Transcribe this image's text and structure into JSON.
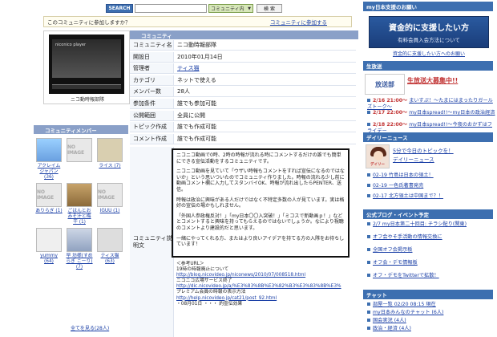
{
  "search": {
    "button": "SEARCH",
    "scope": "コミュニティ内",
    "go": "検 索"
  },
  "join": {
    "question": "このコミュニティに参加しますか？",
    "link": "コミュニティに参加する"
  },
  "left": {
    "caption": "ニコ動時報部隊",
    "members_header": "コミュニティメンバー",
    "no_image": "NO IMAGE",
    "members": [
      {
        "name": "アクレイムジャパン (36)",
        "pic": "anime"
      },
      {
        "name": "",
        "pic": "noimg"
      },
      {
        "name": "",
        "pic": "sign"
      },
      {
        "name": "もっこり (5)",
        "pic": ""
      },
      {
        "name": "ライス (7)",
        "pic": ""
      },
      {
        "name": "",
        "pic": "noimg"
      },
      {
        "name": "",
        "pic": "food"
      },
      {
        "name": "",
        "pic": "noimg"
      },
      {
        "name": "ありらぎ (1)",
        "pic": ""
      },
      {
        "name": "ごはんとおみそ汁と梅干 (1)",
        "pic": ""
      },
      {
        "name": "IGUU (1)",
        "pic": ""
      },
      {
        "name": "yummy (64)",
        "pic": "bear"
      },
      {
        "name": "早 坊様(すめらぎ こーり) (7)",
        "pic": "man"
      },
      {
        "name": "ティス猫 (63)",
        "pic": "cat"
      }
    ],
    "all_members": "全てを見る(28人)"
  },
  "info": {
    "header": "コミュニティ",
    "rows": [
      {
        "k": "コミュニティ名",
        "v": "ニコ動時報部隊"
      },
      {
        "k": "開設日",
        "v": "2010年01月14日"
      },
      {
        "k": "管理者",
        "v": "ティス猫",
        "link": true
      },
      {
        "k": "カテゴリ",
        "v": "ネットで使える"
      },
      {
        "k": "メンバー数",
        "v": "28人"
      },
      {
        "k": "参加条件",
        "v": "誰でも参加可能"
      },
      {
        "k": "公開範囲",
        "v": "全員に公開"
      },
      {
        "k": "トピック作成",
        "v": "誰でも作成可能"
      },
      {
        "k": "コメント作成",
        "v": "誰でも作成可能"
      }
    ],
    "desc_key": "コミュニティ説明文",
    "desc": [
      "ニコニコ動画で0時、2時の時報が流れる時にコメントするだけの誰でも簡単にできる宣伝活動をするコミュニティです。",
      "ニコニコ動画を見ていて「ウザい時報もコメントをすれば宣伝になるのではないか」という思いついたのでコミュニティ作りました。時報の流れる少し前に動画コメント欄に入力してスタンバイOK、時報が流れ出したらPENTER、送信。",
      "時報は政治に興味がある人だけではなく不特定多数の人が見ています。実は格好の宣伝の場かもしれません。",
      "「外国人参政権反対！」「my日本〇〇入突破！」「ミコスで新動画ｐ！」などとコメントすると興味を持ってもらえるのではないでしょうか。なにより視聴のコメントより建設的だと思います。",
      "一緒にやってくれる方、またはより良いアイデアを持てる方の入隊をお待ちしています！"
    ],
    "refs": [
      {
        "t": "＜参考URL＞",
        "u": false
      },
      {
        "t": "19時の時報廃止について",
        "u": false
      },
      {
        "t": "http://blog.nicovideo.jp/niconews/2010/07/008518.html",
        "u": true
      },
      {
        "t": "ニコニコ広場サービス終了",
        "u": false
      },
      {
        "t": "http://dic.nicovideo.jp/a/%E3%83%8B%E3%82%B3%E3%83%8B%E3%",
        "u": true
      },
      {
        "t": "プレミアム会員の時報の表示方法",
        "u": false
      },
      {
        "t": "http://help.nicovideo.jp/cat21/post_92.html",
        "u": true
      },
      {
        "t": "・08月01日 ・・・ 約宣伝効果",
        "u": false
      }
    ]
  },
  "right": {
    "support_header": "my日本支援のお願い",
    "banner_line1": "資金的に支援したい方",
    "banner_line2": "有料会員入会方法について",
    "banner_link": "資金的に支援したい方へのお願い",
    "blog_header": "生放送",
    "blog_logo": "放送部",
    "blog_title": "生放送大募集中!!",
    "news": [
      {
        "d": "2/16 21:00～",
        "t": "まいすぷ！～たまにはまったりガールズトーク～"
      },
      {
        "d": "2/17 22:00～",
        "t": "my日本spread!!～my日本の政治経済"
      },
      {
        "d": "2/18 22:00～",
        "t": "my日本spread!!～今夜のおかずはフライデー"
      }
    ],
    "daily_header": "デイリーニュース",
    "daily_pic_label": "デイリー",
    "daily_t1": "5分で今日のトピックを！",
    "daily_t2": "デイリーニュース",
    "daily": [
      {
        "t": "02-19 竹島は日本の領土！"
      },
      {
        "t": "02-19 一色氏著書発売"
      },
      {
        "t": "02-17 北方領土は中国まで？！"
      }
    ],
    "event_header": "公式ブログ・イベント予定",
    "event": [
      {
        "t": "2/7 my日本第二十回目: チラシ配り(関東)"
      },
      {
        "t": "オフ会やそ手活動の情報交換に"
      },
      {
        "t": "全国オフ会掲示板"
      },
      {
        "t": "オフ会・デモ情報板"
      },
      {
        "t": "オフ・デモをTwitterで拡散！"
      }
    ],
    "chat_header": "チャット",
    "chat": [
      {
        "t": "部屋一覧 02/20 08:15 現在"
      },
      {
        "t": "my日本みんなのチャット (6人)"
      },
      {
        "t": "国会実況 (4人)"
      },
      {
        "t": "政治・経済 (4人)"
      }
    ]
  }
}
